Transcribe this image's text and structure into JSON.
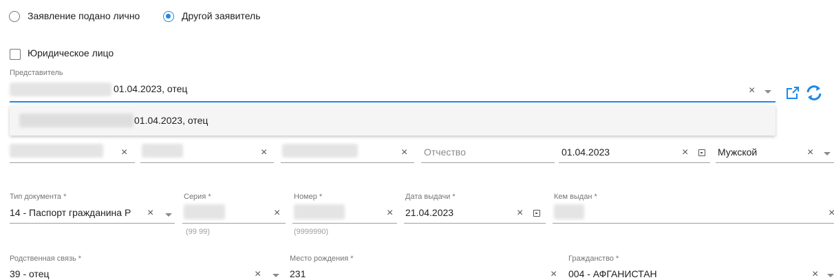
{
  "applicant": {
    "option_personal": "Заявление подано лично",
    "option_other": "Другой заявитель",
    "legal_entity": "Юридическое лицо"
  },
  "representative": {
    "label": "Представитель",
    "value": "01.04.2023, отец",
    "dropdown_item": "01.04.2023, отец"
  },
  "person": {
    "patronymic_placeholder": "Отчество",
    "birth_date": "01.04.2023",
    "gender": "Мужской"
  },
  "document": {
    "type_label": "Тип документа *",
    "type_value": "14 - Паспорт гражданина Р",
    "series_label": "Серия *",
    "series_hint": "(99 99)",
    "number_label": "Номер *",
    "number_hint": "(9999990)",
    "issue_date_label": "Дата выдачи *",
    "issue_date_value": "21.04.2023",
    "issued_by_label": "Кем выдан *"
  },
  "relation": {
    "label": "Родственная связь *",
    "value": "39 - отец"
  },
  "birthplace": {
    "label": "Место рождения *",
    "value": "231"
  },
  "citizenship": {
    "label": "Гражданство *",
    "value": "004 - АФГАНИСТАН"
  },
  "colors": {
    "accent": "#1e88e5"
  }
}
